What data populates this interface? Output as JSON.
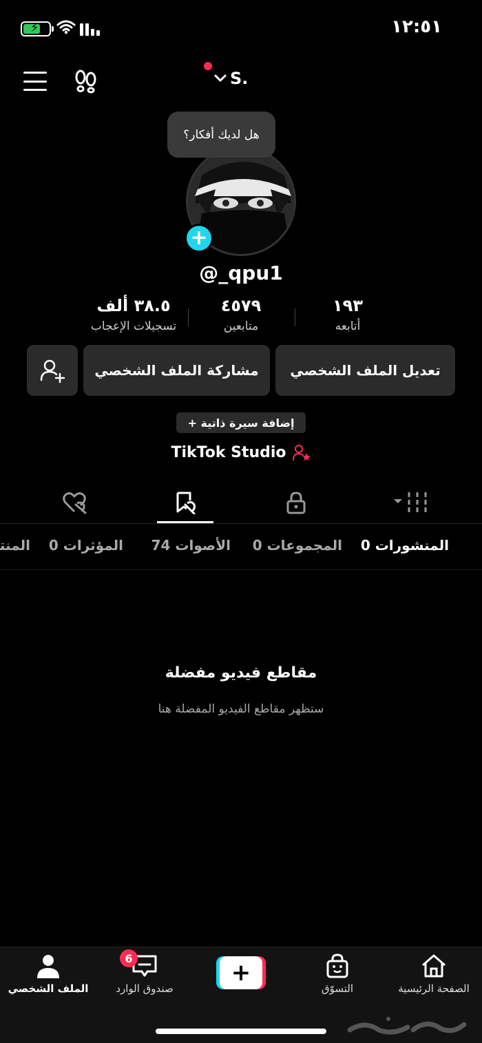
{
  "status_bar": {
    "time": "١٢:٥١"
  },
  "header": {
    "account_name": "S.",
    "menu_icon": "hamburger-icon",
    "footprints_icon": "footprints-icon"
  },
  "profile": {
    "bubble_text": "هل لديك أفكار؟",
    "username": "@_qpu1",
    "stats": {
      "following_value": "١٩٣",
      "following_label": "أتابعه",
      "followers_value": "٤٥٧٩",
      "followers_label": "متابعين",
      "likes_value": "٣٨.٥ ألف",
      "likes_label": "تسجيلات الإعجاب"
    },
    "actions": {
      "edit_profile": "تعديل الملف الشخصي",
      "share_profile": "مشاركة الملف الشخصي"
    },
    "add_bio": "+ إضافة سيرة ذاتية",
    "studio": "TikTok Studio"
  },
  "content_tabs": [
    {
      "icon": "grid-icon",
      "active": false
    },
    {
      "icon": "lock-icon",
      "active": false
    },
    {
      "icon": "bookmark-icon",
      "active": true
    },
    {
      "icon": "heart-hidden-icon",
      "active": false
    }
  ],
  "sub_tabs": {
    "posts": "المنشورات 0",
    "collections": "المجموعات 0",
    "sounds": "الأصوات 74",
    "effects": "المؤثرات 0",
    "products": "المنتجات"
  },
  "empty_state": {
    "title": "مقاطع فيديو مفضلة",
    "subtitle": "ستظهر مقاطع الفيديو المفضلة هنا"
  },
  "bottom_nav": {
    "home": "الصفحة الرئيسية",
    "shop": "التسوّق",
    "inbox": "صندوق الوارد",
    "inbox_badge": "6",
    "profile": "الملف الشخصي"
  },
  "watermark": "حراج",
  "colors": {
    "accent_red": "#fe2c55",
    "accent_cyan": "#20d5ec",
    "battery_green": "#34c759"
  }
}
